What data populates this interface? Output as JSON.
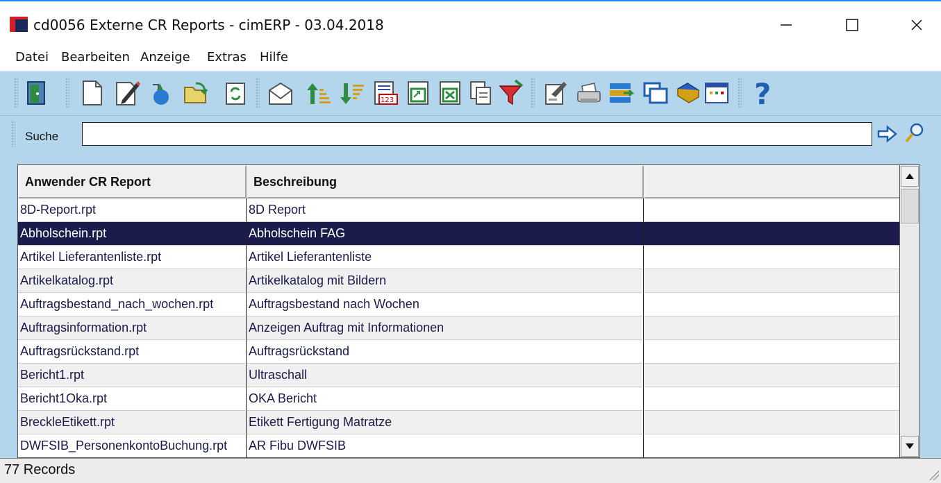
{
  "window": {
    "title": "cd0056 Externe CR Reports - cimERP - 03.04.2018",
    "minimize": "—",
    "maximize": "☐",
    "close": "✕"
  },
  "menu": [
    "Datei",
    "Bearbeiten",
    "Anzeige",
    "Extras",
    "Hilfe"
  ],
  "toolbar": {
    "icons": [
      "exit-icon",
      "new-document-icon",
      "edit-icon",
      "copy-icon",
      "open-folder-icon",
      "refresh-icon",
      "mail-icon",
      "sort-ascending-icon",
      "sort-descending-icon",
      "numbered-list-icon",
      "export-icon",
      "excel-icon",
      "copy-page-icon",
      "filter-icon",
      "properties-icon",
      "print-icon",
      "save-list-icon",
      "windows-icon",
      "book-icon",
      "table-icon",
      "help-icon"
    ]
  },
  "search": {
    "label": "Suche",
    "value": "",
    "go_icon": "arrow-right-icon",
    "find_icon": "magnifier-icon"
  },
  "grid": {
    "columns": [
      "Anwender CR Report",
      "Beschreibung",
      ""
    ],
    "rows": [
      {
        "report": "8D-Report.rpt",
        "desc": "8D Report",
        "extra": ""
      },
      {
        "report": "Abholschein.rpt",
        "desc": "Abholschein FAG",
        "extra": ""
      },
      {
        "report": "Artikel Lieferantenliste.rpt",
        "desc": "Artikel Lieferantenliste",
        "extra": ""
      },
      {
        "report": "Artikelkatalog.rpt",
        "desc": "Artikelkatalog mit Bildern",
        "extra": ""
      },
      {
        "report": "Auftragsbestand_nach_wochen.rpt",
        "desc": "Auftragsbestand nach Wochen",
        "extra": ""
      },
      {
        "report": "Auftragsinformation.rpt",
        "desc": "Anzeigen Auftrag mit Informationen",
        "extra": ""
      },
      {
        "report": "Auftragsrückstand.rpt",
        "desc": "Auftragsrückstand",
        "extra": ""
      },
      {
        "report": "Bericht1.rpt",
        "desc": "Ultraschall",
        "extra": ""
      },
      {
        "report": "Bericht1Oka.rpt",
        "desc": "OKA Bericht",
        "extra": ""
      },
      {
        "report": "BreckleEtikett.rpt",
        "desc": "Etikett Fertigung Matratze",
        "extra": ""
      },
      {
        "report": "DWFSIB_PersonenkontoBuchung.rpt",
        "desc": "AR Fibu DWFSIB",
        "extra": ""
      }
    ],
    "selected_row": "Abholschein.rpt"
  },
  "status": {
    "records": "77 Records"
  },
  "colors": {
    "toolbar_bg": "#b4d6ec",
    "selection_bg": "#1c1c4c",
    "title_accent": "#1e88e5"
  }
}
